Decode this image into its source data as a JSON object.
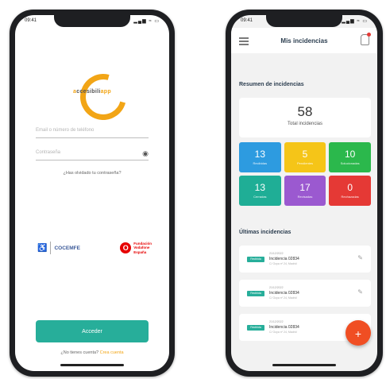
{
  "login": {
    "status_time": "09:41",
    "status_icons": "▂▄▆ ≈ ▭",
    "logo_pre": "a",
    "logo_mid": "ccesibili",
    "logo_post": "app",
    "email_placeholder": "Email o número de teléfono",
    "password_placeholder": "Contraseña",
    "forgot_password": "¿Has olvidado tu contraseña?",
    "partner_cocemfe": "COCEMFE",
    "partner_vodafone_logo": "O",
    "partner_vodafone_1": "Fundación",
    "partner_vodafone_2": "Vodafone",
    "partner_vodafone_3": "España",
    "access_button": "Acceder",
    "no_account": "¿No tienes cuenta?",
    "create_account": "Crea cuenta"
  },
  "incidents": {
    "status_time": "09:41",
    "status_icons": "▂▄▆ ≈ ▭",
    "title": "Mis incidencias",
    "summary_heading": "Resumen de incidencias",
    "total_value": "58",
    "total_label": "Total incidencias",
    "tiles": [
      {
        "value": "13",
        "label": "Recibidas",
        "color": "#2d9be0"
      },
      {
        "value": "5",
        "label": "Pendientes",
        "color": "#f5c518"
      },
      {
        "value": "10",
        "label": "Solucionadas",
        "color": "#2bb84c"
      },
      {
        "value": "13",
        "label": "Cerradas",
        "color": "#1fae96"
      },
      {
        "value": "17",
        "label": "Revisadas",
        "color": "#9b59d0"
      },
      {
        "value": "0",
        "label": "Rechazadas",
        "color": "#e53935"
      }
    ],
    "recent_heading": "Últimas incidencias",
    "items": [
      {
        "status": "Recibida",
        "meta": "21/12/2022",
        "name": "Incidencia 02834",
        "sub": "C/ Goya nº 24, Madrid"
      },
      {
        "status": "Recibida",
        "meta": "21/12/2022",
        "name": "Incidencia 02834",
        "sub": "C/ Goya nº 24, Madrid"
      },
      {
        "status": "Recibida",
        "meta": "21/12/2022",
        "name": "Incidencia 02834",
        "sub": "C/ Goya nº 24, Madrid"
      }
    ],
    "fab_label": "+"
  }
}
